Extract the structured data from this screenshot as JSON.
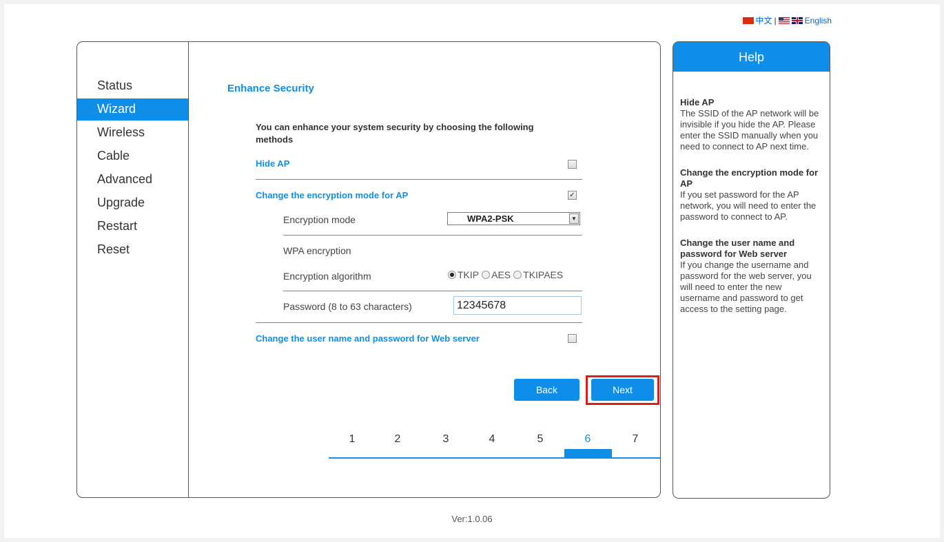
{
  "language": {
    "chinese": "中文",
    "separator": "|",
    "english": "English"
  },
  "sidebar": {
    "items": [
      {
        "label": "Status"
      },
      {
        "label": "Wizard"
      },
      {
        "label": "Wireless"
      },
      {
        "label": "Cable"
      },
      {
        "label": "Advanced"
      },
      {
        "label": "Upgrade"
      },
      {
        "label": "Restart"
      },
      {
        "label": "Reset"
      }
    ],
    "active": "Wizard"
  },
  "main": {
    "title": "Enhance Security",
    "intro": "You can enhance your system security by choosing the following methods",
    "hide_ap": {
      "label": "Hide AP",
      "checked": false
    },
    "encryption": {
      "label": "Change the encryption mode for AP",
      "checked": true,
      "mode_label": "Encryption mode",
      "mode_value": "WPA2-PSK",
      "wpa_label": "WPA encryption",
      "algorithm_label": "Encryption algorithm",
      "algorithms": [
        "TKIP",
        "AES",
        "TKIPAES"
      ],
      "selected_algorithm": "TKIP",
      "password_label": "Password (8 to 63 characters)",
      "password_value": "12345678"
    },
    "web_server": {
      "label": "Change the user name and password for Web server",
      "checked": false
    },
    "buttons": {
      "back": "Back",
      "next": "Next"
    },
    "steps": [
      "1",
      "2",
      "3",
      "4",
      "5",
      "6",
      "7"
    ],
    "current_step": "6"
  },
  "help": {
    "header": "Help",
    "sections": [
      {
        "title": "Hide AP",
        "text": "The SSID of the AP network will be invisible if you hide the AP. Please enter the SSID manually when you need to connect to AP next time."
      },
      {
        "title": "Change the encryption mode for AP",
        "text": "If you set password for the AP network, you will need to enter the password to connect to AP."
      },
      {
        "title": "Change the user name and password for Web server",
        "text": "If you change the username and password for the web server, you will need to enter the new username and password to get access to the setting page."
      }
    ]
  },
  "footer": {
    "version": "Ver:1.0.06"
  },
  "colors": {
    "accent": "#0e8ee8",
    "highlight": "#e01b1b"
  }
}
